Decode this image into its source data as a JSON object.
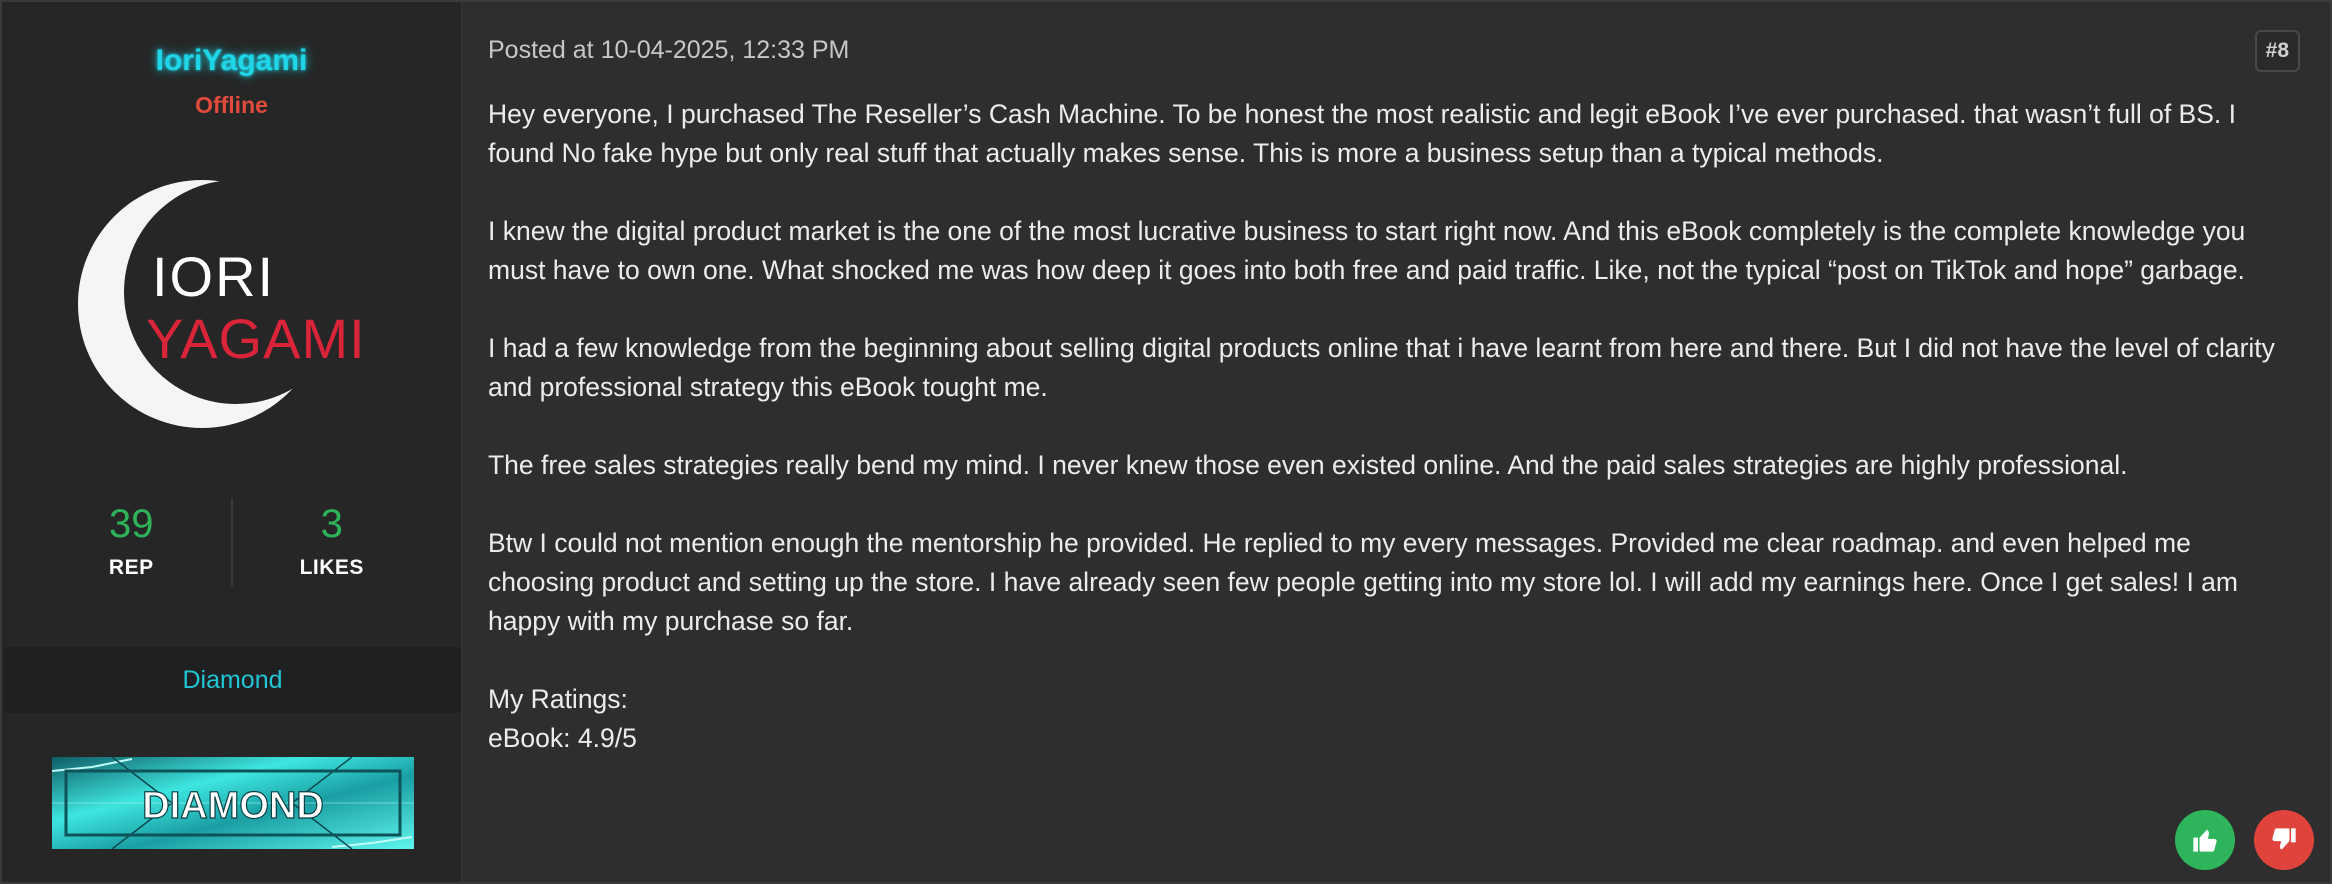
{
  "user": {
    "username": "IoriYagami",
    "status": "Offline",
    "avatar_logo_line1": "IORI",
    "avatar_logo_line2": "YAGAMI",
    "reputation": "39",
    "reputation_label": "REP",
    "likes": "3",
    "likes_label": "LIKES",
    "rank": "Diamond",
    "rank_badge_text": "DIAMOND"
  },
  "post": {
    "date": "Posted at 10-04-2025, 12:33 PM",
    "number": "#8",
    "paragraphs": [
      "Hey everyone, I purchased The Reseller’s Cash Machine. To be honest the most realistic and legit eBook I’ve ever purchased. that wasn’t full of BS. I found No fake hype but only real stuff that actually makes sense. This is more a business setup than a typical methods.",
      "I knew the digital product market is the one of the most lucrative business to start right now. And this eBook completely is the complete knowledge you must have to own one. What shocked me was how deep it goes into both free and paid traffic. Like, not the typical “post on TikTok and hope” garbage.",
      "I had a few knowledge from the beginning about selling digital products online that i have learnt from here and there. But I did not have the level of clarity and professional strategy this eBook tought me.",
      "The free sales strategies really bend my mind. I never knew those even existed online. And the paid sales strategies are highly professional.",
      "Btw I could not mention enough the mentorship he provided. He replied to my every messages. Provided me clear roadmap. and even helped me choosing product and setting up the store. I have already seen few people getting into my store lol. I will add my earnings here. Once I get sales! I am happy with my purchase so far.",
      "My Ratings:",
      "eBook: 4.9/5"
    ]
  },
  "actions": {
    "like_icon": "thumbs-up-icon",
    "dislike_icon": "thumbs-down-icon"
  },
  "colors": {
    "username": "#1fd6e8",
    "offline": "#e24a3b",
    "stat_value": "#2fb35a",
    "rank": "#20c6d4",
    "like": "#2eb55c",
    "dislike": "#e0433c"
  }
}
